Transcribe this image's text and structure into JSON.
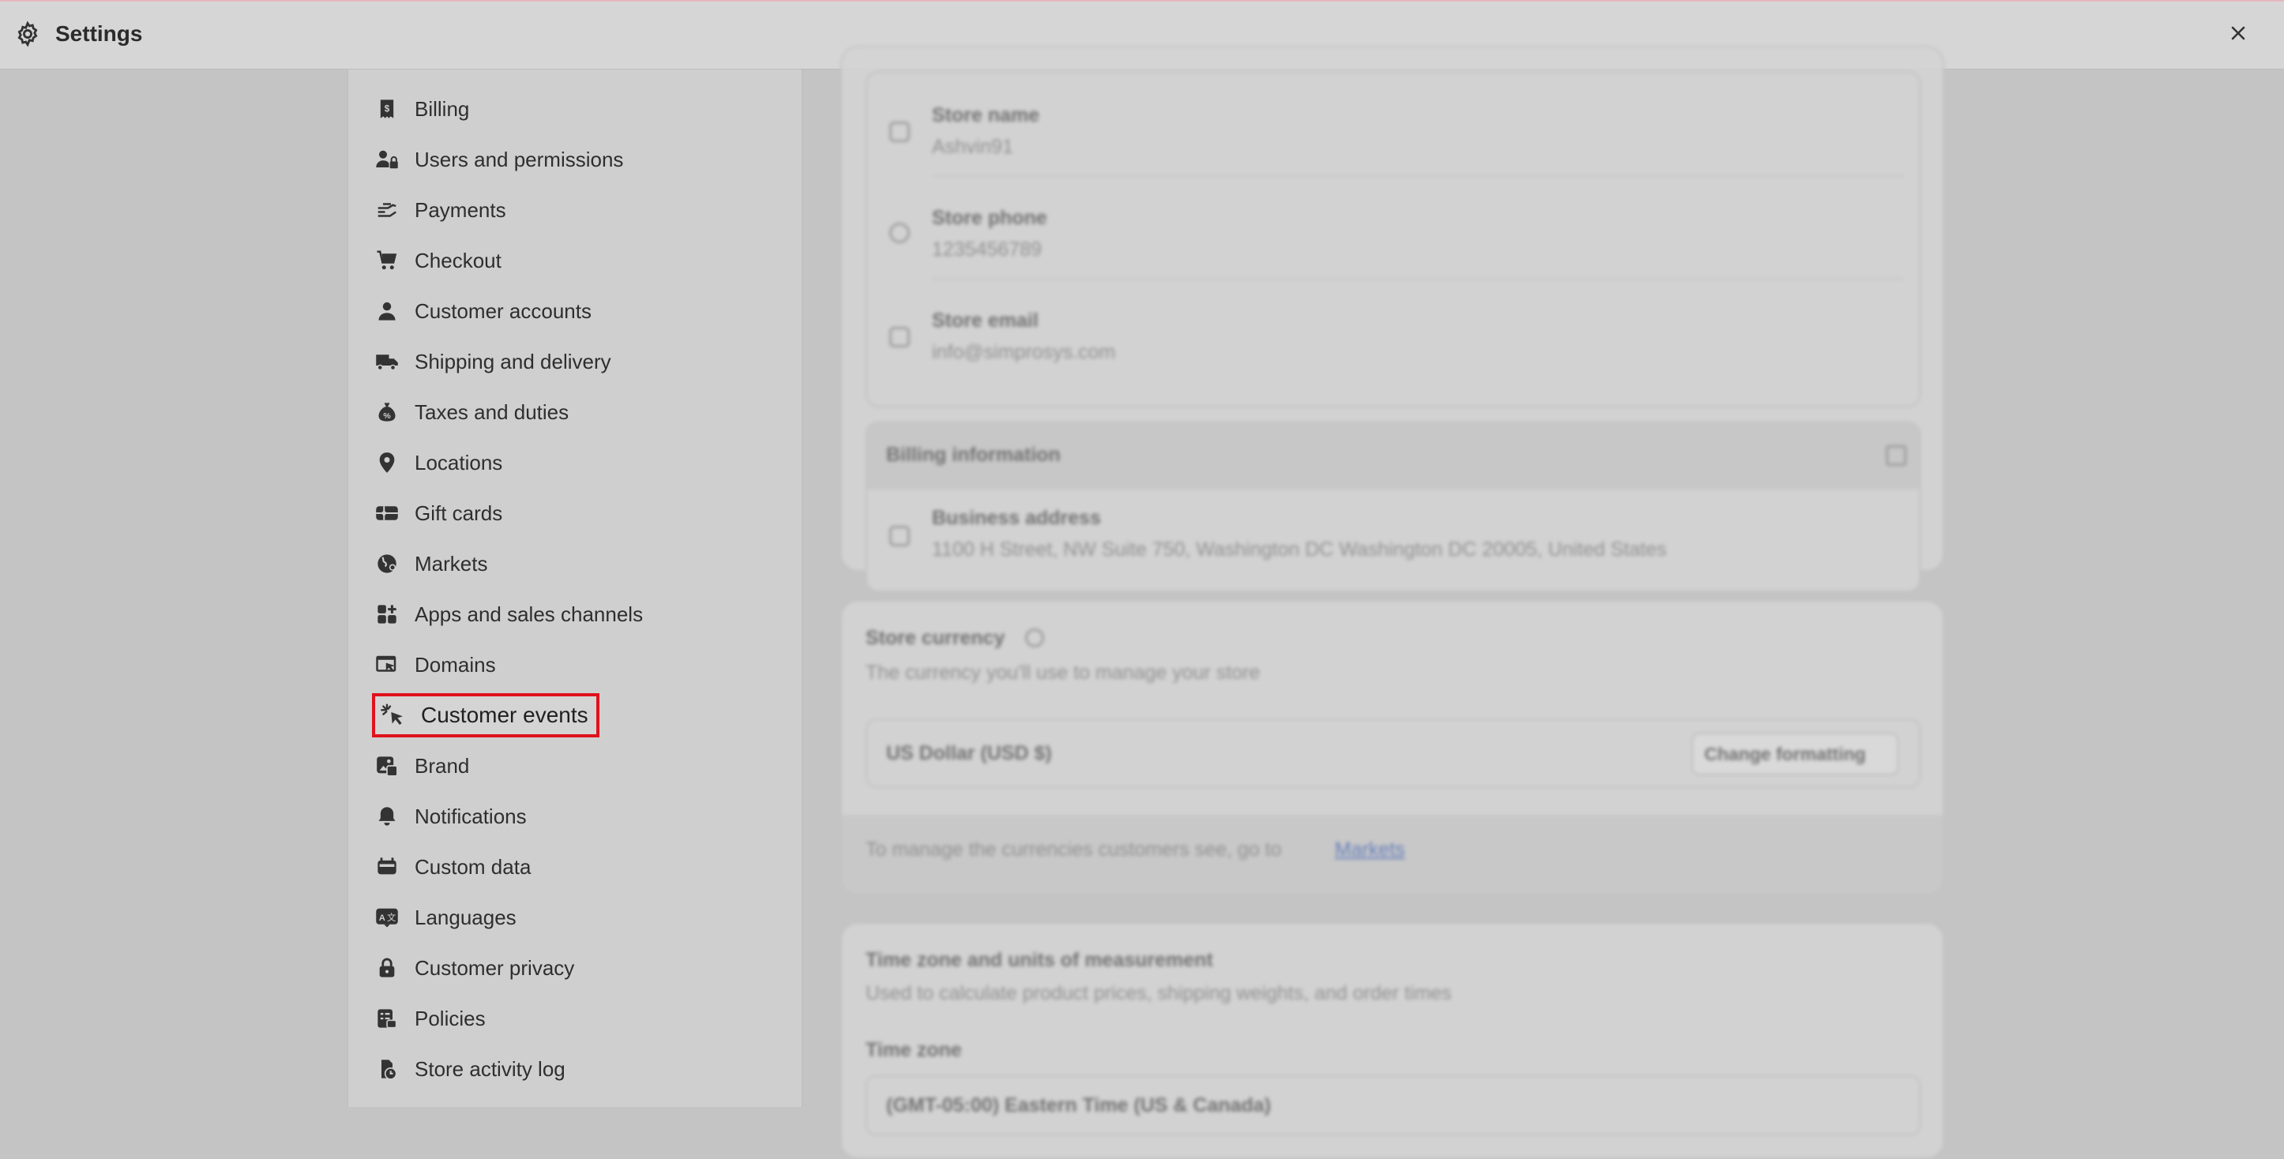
{
  "header": {
    "title": "Settings",
    "icon": "gear-icon",
    "close_icon": "close-icon"
  },
  "sidebar": {
    "items": [
      {
        "label": "Billing",
        "icon": "billing-receipt-icon"
      },
      {
        "label": "Users and permissions",
        "icon": "users-lock-icon"
      },
      {
        "label": "Payments",
        "icon": "payments-hand-icon"
      },
      {
        "label": "Checkout",
        "icon": "cart-icon"
      },
      {
        "label": "Customer accounts",
        "icon": "person-icon"
      },
      {
        "label": "Shipping and delivery",
        "icon": "truck-icon"
      },
      {
        "label": "Taxes and duties",
        "icon": "money-bag-icon"
      },
      {
        "label": "Locations",
        "icon": "location-pin-icon"
      },
      {
        "label": "Gift cards",
        "icon": "gift-card-icon"
      },
      {
        "label": "Markets",
        "icon": "globe-icon"
      },
      {
        "label": "Apps and sales channels",
        "icon": "apps-grid-icon"
      },
      {
        "label": "Domains",
        "icon": "domains-icon"
      },
      {
        "label": "Customer events",
        "icon": "cursor-click-icon",
        "active": true
      },
      {
        "label": "Brand",
        "icon": "brand-image-icon"
      },
      {
        "label": "Notifications",
        "icon": "bell-icon"
      },
      {
        "label": "Custom data",
        "icon": "custom-data-icon"
      },
      {
        "label": "Languages",
        "icon": "translate-icon"
      },
      {
        "label": "Customer privacy",
        "icon": "lock-icon"
      },
      {
        "label": "Policies",
        "icon": "policies-list-icon"
      },
      {
        "label": "Store activity log",
        "icon": "activity-log-icon"
      }
    ],
    "highlight_color": "#e0121c"
  },
  "main": {
    "store_details": {
      "store_name_label": "Store name",
      "store_name_value": "Ashvin91",
      "store_phone_label": "Store phone",
      "store_phone_value": "1235456789",
      "store_email_label": "Store email",
      "store_email_value": "info@simprosys.com"
    },
    "billing_info": {
      "title": "Billing information",
      "address_label": "Business address",
      "address_value": "1100 H Street, NW Suite 750, Washington DC Washington DC 20005, United States"
    },
    "store_currency": {
      "title": "Store currency",
      "subtitle": "The currency you'll use to manage your store",
      "currency_value": "US Dollar (USD $)",
      "change_button": "Change formatting",
      "footer_text": "To manage the currencies customers see, go to",
      "footer_link": "Markets"
    },
    "timezone": {
      "title": "Time zone and units of measurement",
      "subtitle": "Used to calculate product prices, shipping weights, and order times",
      "field_label": "Time zone",
      "field_value": "(GMT-05:00) Eastern Time (US & Canada)"
    }
  }
}
